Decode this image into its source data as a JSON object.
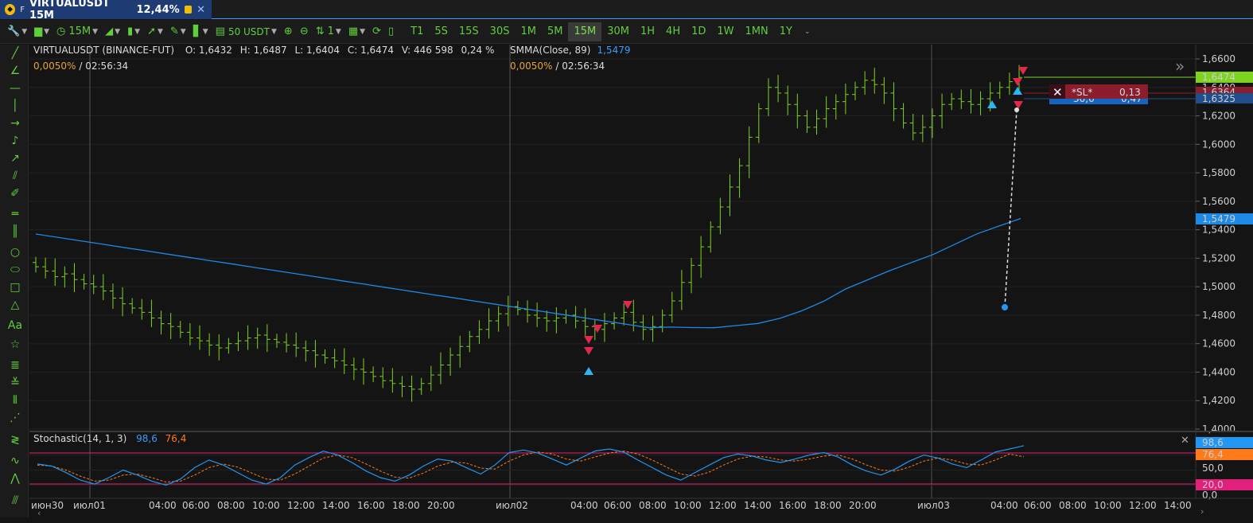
{
  "tab": {
    "exchange_badge": "F",
    "title": "VIRTUALUSDT 15M",
    "change": "12,44%",
    "close_icon": "✕"
  },
  "toolbar": {
    "interval": "15M",
    "quantity": "50 USDT",
    "lots": "1",
    "timeframes": [
      "T1",
      "5S",
      "15S",
      "30S",
      "1M",
      "5M",
      "15M",
      "30M",
      "1H",
      "4H",
      "1D",
      "1W",
      "1MN",
      "1Y"
    ],
    "active_timeframe": "15M"
  },
  "legend": {
    "symbol": "VIRTUALUSDT (BINANCE-FUT)",
    "open": "O: 1,6432",
    "high": "H: 1,6487",
    "low": "L: 1,6404",
    "close": "C: 1,6474",
    "volume": "V: 446 598",
    "change_pct": "0,24 %",
    "spread": "0,0050%",
    "timer": "/ 02:56:34",
    "ma_name": "SMMA(Close, 89)",
    "ma_value": "1,5479",
    "ma_spread": "0,0050%",
    "ma_timer": "/ 02:56:34"
  },
  "price_axis": {
    "ticks": [
      "1,6600",
      "1,6400",
      "1,6200",
      "1,6000",
      "1,5800",
      "1,5600",
      "1,5400",
      "1,5200",
      "1,5000",
      "1,4800",
      "1,4600",
      "1,4400",
      "1,4200",
      "1,4000"
    ],
    "last_price_label": "1,6474",
    "ma_price_label": "1,5479",
    "sl_price_label": "1,6364",
    "position_price_label": "1,6325"
  },
  "order_lines": {
    "sl_label": "*SL*",
    "sl_value": "0,13",
    "pos_label": "30,0",
    "pos_value": "0,47"
  },
  "stochastic": {
    "name": "Stochastic(14, 1, 3)",
    "k_value": "98,6",
    "d_value": "76,4",
    "ticks": [
      "50,0",
      "0,0"
    ],
    "level_label": "20,0",
    "close_icon": "✕"
  },
  "time_axis": {
    "labels": [
      "июн30",
      "июл01",
      "04:00",
      "06:00",
      "08:00",
      "10:00",
      "12:00",
      "14:00",
      "16:00",
      "18:00",
      "20:00",
      "июл02",
      "04:00",
      "06:00",
      "08:00",
      "10:00",
      "12:00",
      "14:00",
      "16:00",
      "18:00",
      "20:00",
      "июл03",
      "04:00",
      "06:00",
      "08:00",
      "10:00",
      "12:00",
      "14:00"
    ]
  },
  "colors": {
    "bull": "#7ed321",
    "ma": "#1e88e5",
    "last": "#7ed321",
    "sl": "#8b1d2c",
    "stoch_k": "#2196f3",
    "stoch_d": "#ff7a1a",
    "level": "#e0207a"
  },
  "chart_data": {
    "type": "candlestick",
    "interval": "15M",
    "y_range": [
      1.4,
      1.66
    ],
    "closes": [
      1.514,
      1.511,
      1.507,
      1.509,
      1.505,
      1.502,
      1.5,
      1.497,
      1.492,
      1.488,
      1.485,
      1.482,
      1.478,
      1.474,
      1.472,
      1.468,
      1.464,
      1.462,
      1.459,
      1.457,
      1.46,
      1.462,
      1.464,
      1.466,
      1.463,
      1.461,
      1.459,
      1.457,
      1.455,
      1.452,
      1.45,
      1.448,
      1.445,
      1.442,
      1.44,
      1.437,
      1.434,
      1.432,
      1.43,
      1.428,
      1.432,
      1.438,
      1.445,
      1.452,
      1.458,
      1.465,
      1.47,
      1.476,
      1.481,
      1.486,
      1.484,
      1.48,
      1.478,
      1.476,
      1.478,
      1.48,
      1.476,
      1.472,
      1.47,
      1.474,
      1.478,
      1.482,
      1.475,
      1.47,
      1.472,
      1.48,
      1.49,
      1.503,
      1.515,
      1.528,
      1.542,
      1.556,
      1.57,
      1.585,
      1.605,
      1.625,
      1.64,
      1.636,
      1.628,
      1.62,
      1.612,
      1.618,
      1.625,
      1.63,
      1.635,
      1.64,
      1.645,
      1.642,
      1.636,
      1.625,
      1.615,
      1.608,
      1.612,
      1.62,
      1.628,
      1.632,
      1.63,
      1.628,
      1.632,
      1.636,
      1.64,
      1.644,
      1.647
    ],
    "smma_89": [
      1.537,
      1.5347,
      1.5323,
      1.53,
      1.5276,
      1.5253,
      1.5229,
      1.5206,
      1.5182,
      1.5159,
      1.5135,
      1.5112,
      1.5088,
      1.5065,
      1.5041,
      1.5018,
      1.4994,
      1.4971,
      1.4947,
      1.4924,
      1.49,
      1.4877,
      1.4853,
      1.483,
      1.4806,
      1.4783,
      1.4759,
      1.4736,
      1.4712,
      1.4716,
      1.4713,
      1.4712,
      1.4727,
      1.4742,
      1.4778,
      1.4831,
      1.4898,
      1.4984,
      1.5048,
      1.5112,
      1.5169,
      1.5226,
      1.5299,
      1.5371,
      1.5426,
      1.5479
    ],
    "stochastic_k": [
      62,
      58,
      45,
      30,
      22,
      35,
      50,
      40,
      28,
      20,
      32,
      55,
      70,
      60,
      45,
      30,
      22,
      35,
      60,
      75,
      88,
      80,
      65,
      48,
      35,
      28,
      40,
      58,
      72,
      68,
      55,
      42,
      60,
      85,
      90,
      84,
      72,
      60,
      74,
      88,
      92,
      86,
      70,
      55,
      40,
      30,
      45,
      60,
      75,
      82,
      78,
      70,
      65,
      72,
      80,
      85,
      76,
      60,
      48,
      40,
      52,
      68,
      80,
      74,
      62,
      55,
      70,
      86,
      92,
      98.6
    ],
    "stochastic_d": [
      60,
      58,
      50,
      38,
      28,
      30,
      40,
      42,
      35,
      26,
      28,
      40,
      55,
      62,
      56,
      44,
      32,
      30,
      42,
      58,
      74,
      80,
      75,
      62,
      48,
      36,
      34,
      44,
      58,
      66,
      64,
      54,
      52,
      68,
      80,
      86,
      82,
      72,
      68,
      76,
      84,
      88,
      82,
      70,
      56,
      42,
      38,
      46,
      60,
      72,
      78,
      76,
      70,
      68,
      72,
      78,
      80,
      72,
      60,
      50,
      48,
      56,
      68,
      74,
      70,
      62,
      60,
      70,
      82,
      76.4
    ],
    "levels": [
      80,
      20
    ]
  }
}
